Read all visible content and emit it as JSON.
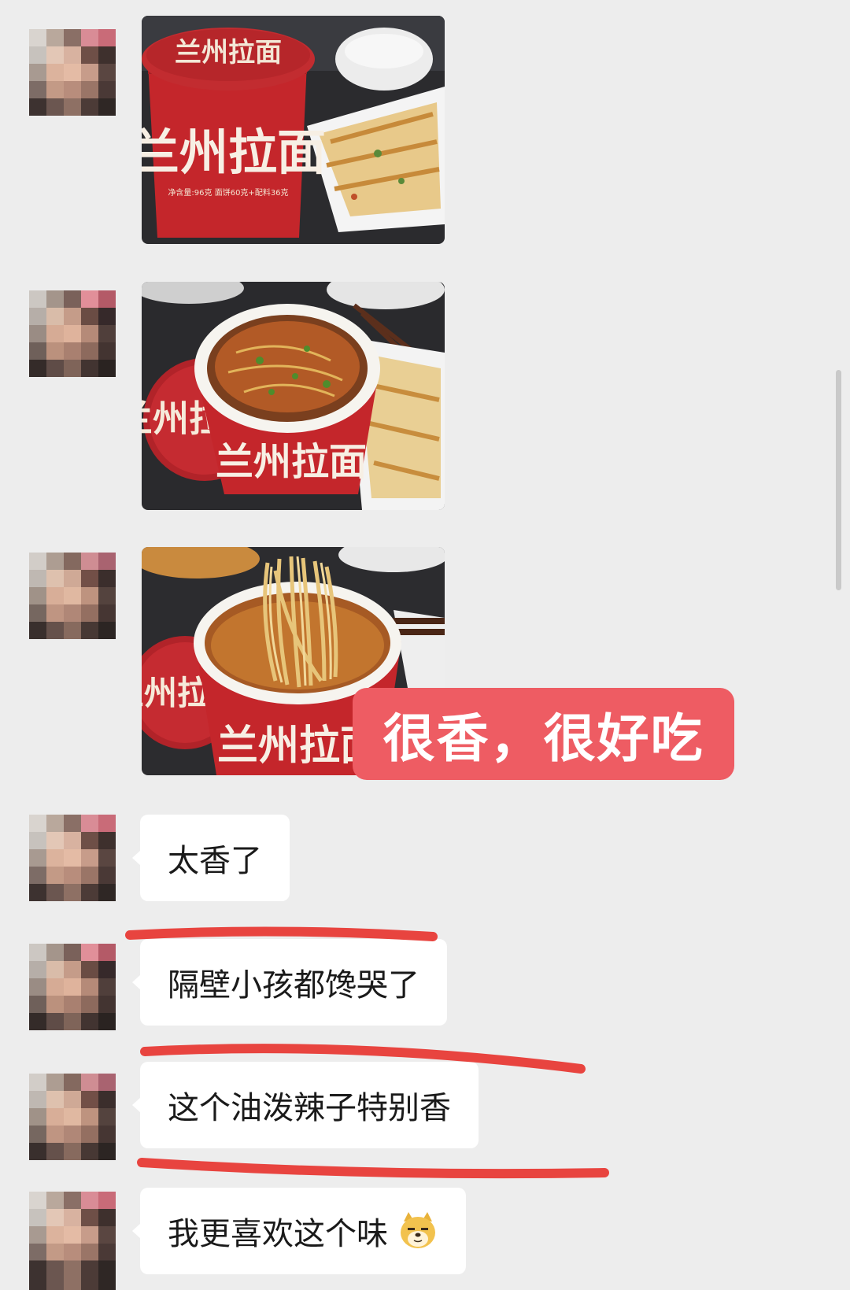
{
  "chat": {
    "caption": "很香，很好吃",
    "messages": [
      {
        "text": "太香了"
      },
      {
        "text": "隔壁小孩都馋哭了"
      },
      {
        "text": "这个油泼辣子特别香"
      },
      {
        "text": "我更喜欢这个味",
        "emoji": "doge-emoji"
      }
    ]
  },
  "photos": [
    {
      "cup_brand": "兰州拉面",
      "lid_text": "兰州拉面",
      "net_weight": "净含量:96克  面饼60克+配料36克"
    },
    {
      "cup_brand": "兰州拉面",
      "lid_text": "兰州拉面"
    },
    {
      "cup_brand": "兰州拉面",
      "lid_text": "兰州拉面"
    }
  ],
  "colors": {
    "highlight_caption": "#ee5c63",
    "underline": "#e8443f",
    "background": "#ededed"
  }
}
